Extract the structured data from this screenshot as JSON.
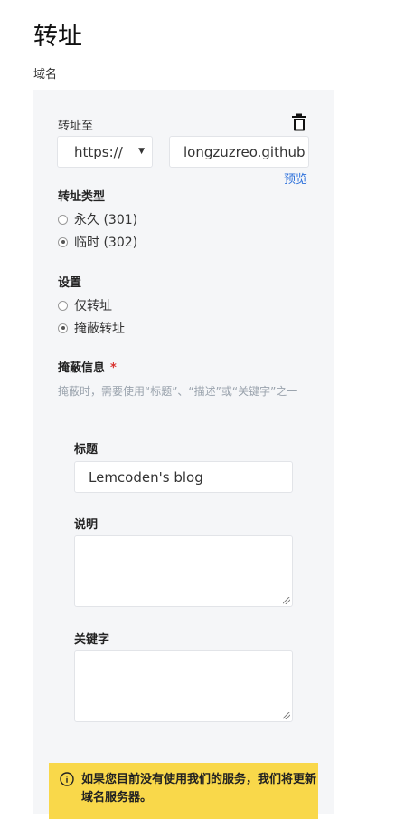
{
  "header": {
    "title": "转址"
  },
  "domain_label": "域名",
  "forward_to": {
    "label": "转址至",
    "protocol_value": "https://",
    "url_value": "longzuzreo.github",
    "preview_link": "预览"
  },
  "forward_type": {
    "label": "转址类型",
    "options": [
      {
        "label": "永久 (301)",
        "checked": false
      },
      {
        "label": "临时 (302)",
        "checked": true
      }
    ]
  },
  "settings": {
    "label": "设置",
    "options": [
      {
        "label": "仅转址",
        "checked": false
      },
      {
        "label": "掩蔽转址",
        "checked": true
      }
    ]
  },
  "masking": {
    "label": "掩蔽信息",
    "required_mark": "*",
    "hint": "掩蔽时，需要使用“标题”、“描述”或“关键字”之一",
    "title_label": "标题",
    "title_value": "Lemcoden's blog",
    "description_label": "说明",
    "description_value": "",
    "keywords_label": "关键字",
    "keywords_value": ""
  },
  "notice": {
    "text": "如果您目前没有使用我们的服务，我们将更新域名服务器。",
    "icon": "info-icon"
  }
}
